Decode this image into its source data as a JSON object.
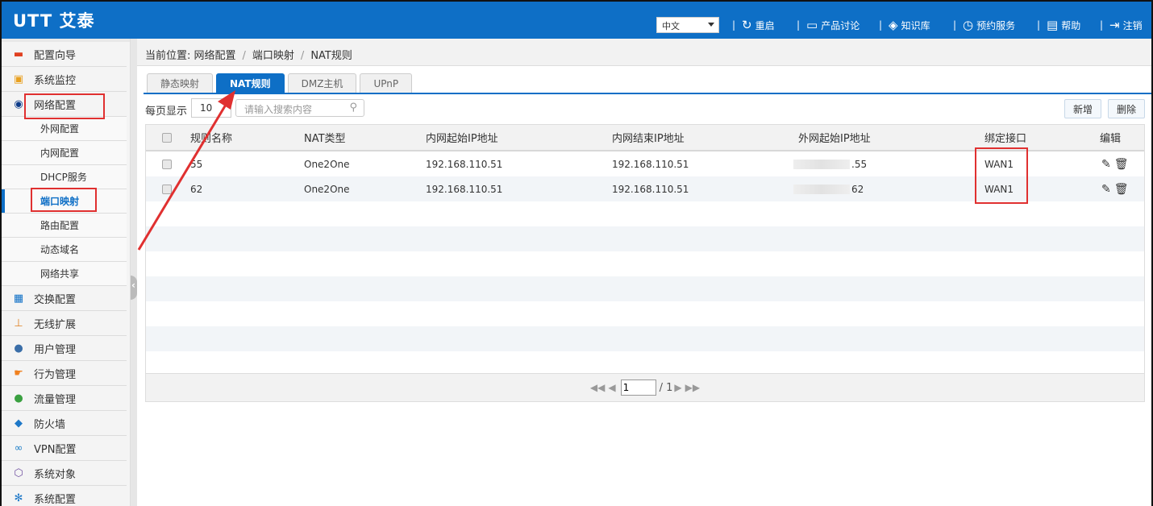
{
  "header": {
    "logo": "UTT 艾泰",
    "language": "中文",
    "nav": [
      {
        "label": "重启",
        "icon": "restart-icon"
      },
      {
        "label": "产品讨论",
        "icon": "chat-icon"
      },
      {
        "label": "知识库",
        "icon": "layers-icon"
      },
      {
        "label": "预约服务",
        "icon": "clock-icon"
      },
      {
        "label": "帮助",
        "icon": "book-icon"
      },
      {
        "label": "注销",
        "icon": "logout-icon"
      }
    ]
  },
  "sidebar": {
    "items": [
      {
        "label": "配置向导",
        "icon": "wizard-icon",
        "color": "#e04020"
      },
      {
        "label": "系统监控",
        "icon": "monitor-icon",
        "color": "#e8a020"
      },
      {
        "label": "网络配置",
        "icon": "network-icon",
        "color": "#0e3c8a"
      },
      {
        "label": "交换配置",
        "icon": "switch-icon",
        "color": "#0e6fc6"
      },
      {
        "label": "无线扩展",
        "icon": "wireless-icon",
        "color": "#e08020"
      },
      {
        "label": "用户管理",
        "icon": "users-icon",
        "color": "#3a6ea8"
      },
      {
        "label": "行为管理",
        "icon": "hand-icon",
        "color": "#f0801e"
      },
      {
        "label": "流量管理",
        "icon": "traffic-icon",
        "color": "#3aa040"
      },
      {
        "label": "防火墙",
        "icon": "shield-icon",
        "color": "#1e78c8"
      },
      {
        "label": "VPN配置",
        "icon": "vpn-icon",
        "color": "#2080c8"
      },
      {
        "label": "系统对象",
        "icon": "cube-icon",
        "color": "#7050a0"
      },
      {
        "label": "系统配置",
        "icon": "gear-icon",
        "color": "#1e78c8"
      }
    ],
    "sub_items": [
      "外网配置",
      "内网配置",
      "DHCP服务",
      "端口映射",
      "路由配置",
      "动态域名",
      "网络共享"
    ],
    "active_sub": "端口映射"
  },
  "breadcrumb": {
    "prefix": "当前位置: 网络配置",
    "mid": "端口映射",
    "current": "NAT规则"
  },
  "tabs": [
    "静态映射",
    "NAT规则",
    "DMZ主机",
    "UPnP"
  ],
  "active_tab": "NAT规则",
  "toolbar": {
    "per_page_label": "每页显示",
    "per_page_value": "10",
    "search_placeholder": "请输入搜索内容",
    "add_label": "新增",
    "delete_label": "删除"
  },
  "table": {
    "columns": [
      "规则名称",
      "NAT类型",
      "内网起始IP地址",
      "内网结束IP地址",
      "外网起始IP地址",
      "绑定接口",
      "编辑"
    ],
    "rows": [
      {
        "name": "55",
        "nat_type": "One2One",
        "inner_start": "192.168.110.51",
        "inner_end": "192.168.110.51",
        "outer_start_suffix": ".55",
        "interface": "WAN1"
      },
      {
        "name": "62",
        "nat_type": "One2One",
        "inner_start": "192.168.110.51",
        "inner_end": "192.168.110.51",
        "outer_start_suffix": "62",
        "interface": "WAN1"
      }
    ]
  },
  "pager": {
    "current_page": "1",
    "total": "/ 1"
  },
  "colors": {
    "brand_blue": "#0e6fc6",
    "annotation_red": "#e03030"
  }
}
